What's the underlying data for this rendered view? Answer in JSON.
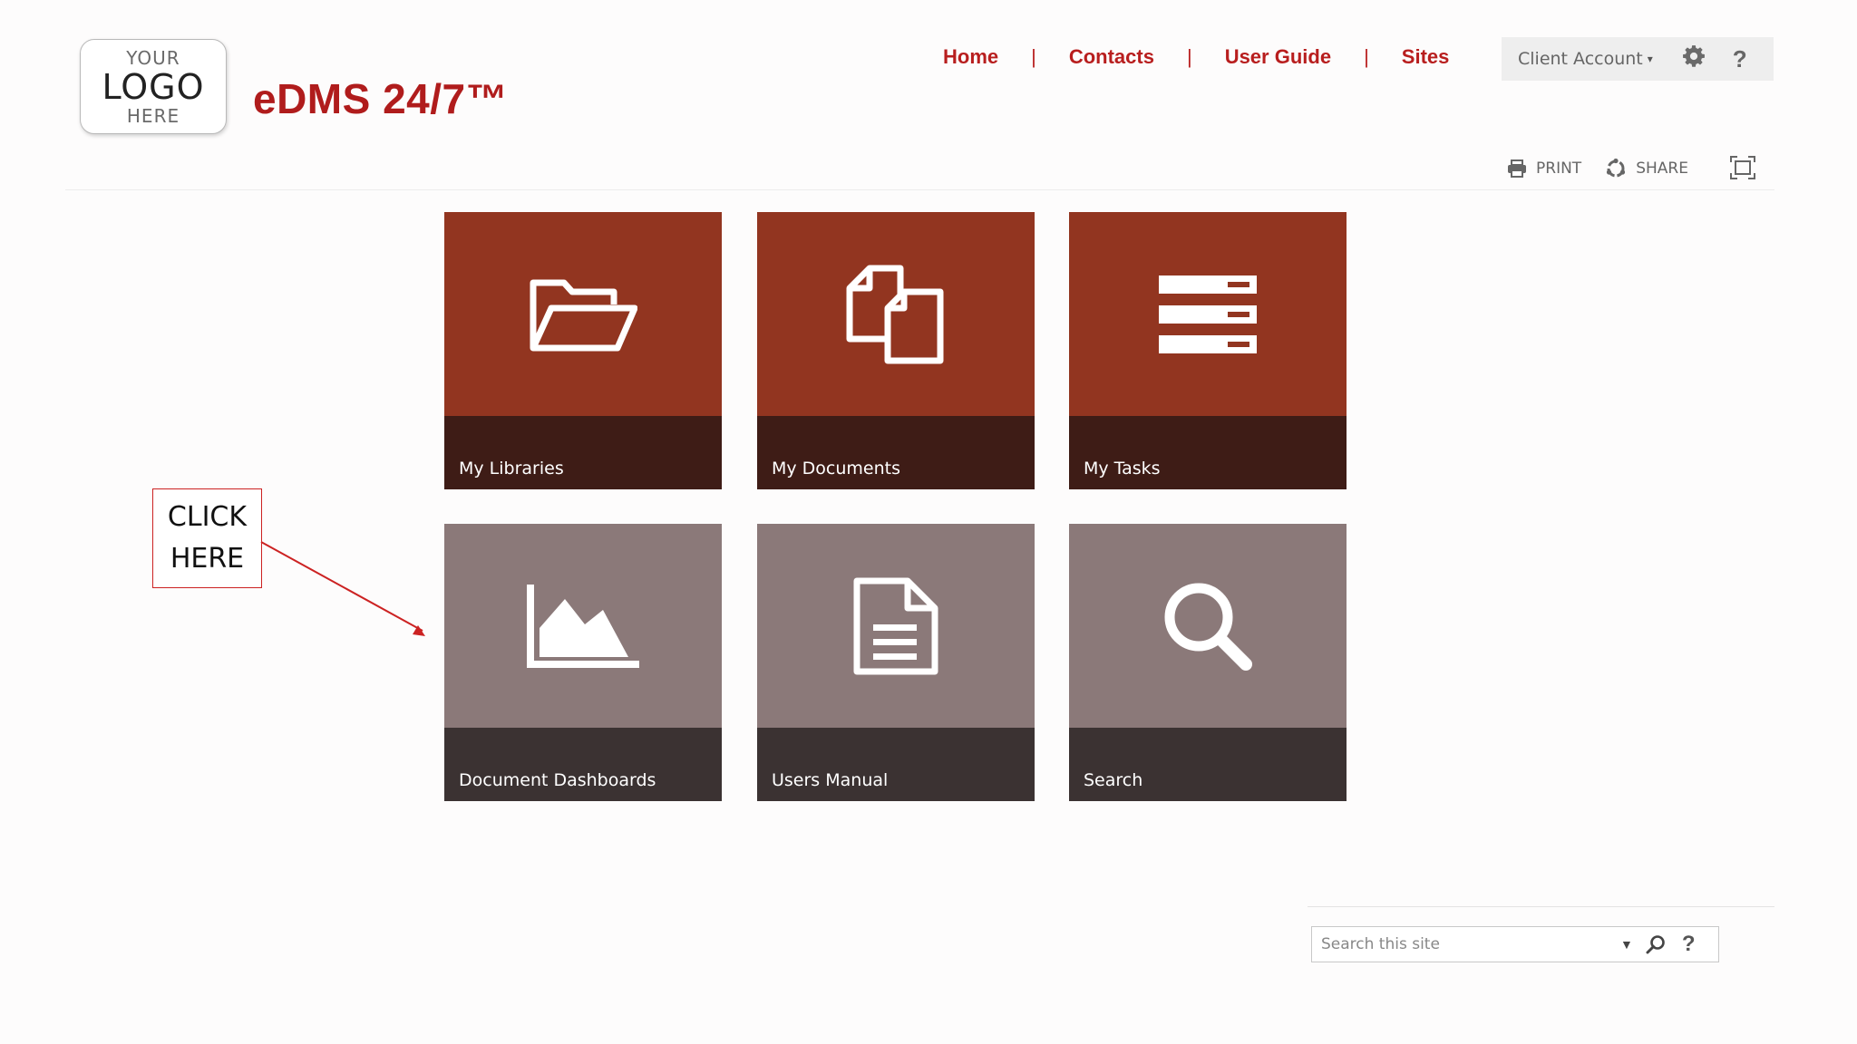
{
  "logo": {
    "line1": "YOUR",
    "line2": "LOGO",
    "line3": "HERE"
  },
  "brand": {
    "title": "eDMS 24/7™",
    "color": "#b01c1c"
  },
  "topnav": {
    "items": [
      {
        "label": "Home"
      },
      {
        "label": "Contacts"
      },
      {
        "label": "User Guide"
      },
      {
        "label": "Sites"
      }
    ],
    "separator": "|"
  },
  "account": {
    "label": "Client Account",
    "caret": "▾",
    "help": "?"
  },
  "actions": {
    "print": "PRINT",
    "share": "SHARE"
  },
  "tiles": [
    {
      "label": "My Libraries",
      "icon": "folder-open-icon",
      "theme": "red"
    },
    {
      "label": "My Documents",
      "icon": "documents-copy-icon",
      "theme": "red"
    },
    {
      "label": "My Tasks",
      "icon": "tasks-list-icon",
      "theme": "red"
    },
    {
      "label": "Document Dashboards",
      "icon": "area-chart-icon",
      "theme": "grey"
    },
    {
      "label": "Users Manual",
      "icon": "document-text-icon",
      "theme": "grey"
    },
    {
      "label": "Search",
      "icon": "magnifier-icon",
      "theme": "grey"
    }
  ],
  "colors": {
    "tile_red_top": "#923520",
    "tile_red_bottom": "#3e1c16",
    "tile_grey_top": "#8b7979",
    "tile_grey_bottom": "#3b3232",
    "callout_border": "#c22222"
  },
  "callout": {
    "line1": "CLICK",
    "line2": "HERE"
  },
  "search": {
    "placeholder": "Search this site",
    "help": "?"
  }
}
